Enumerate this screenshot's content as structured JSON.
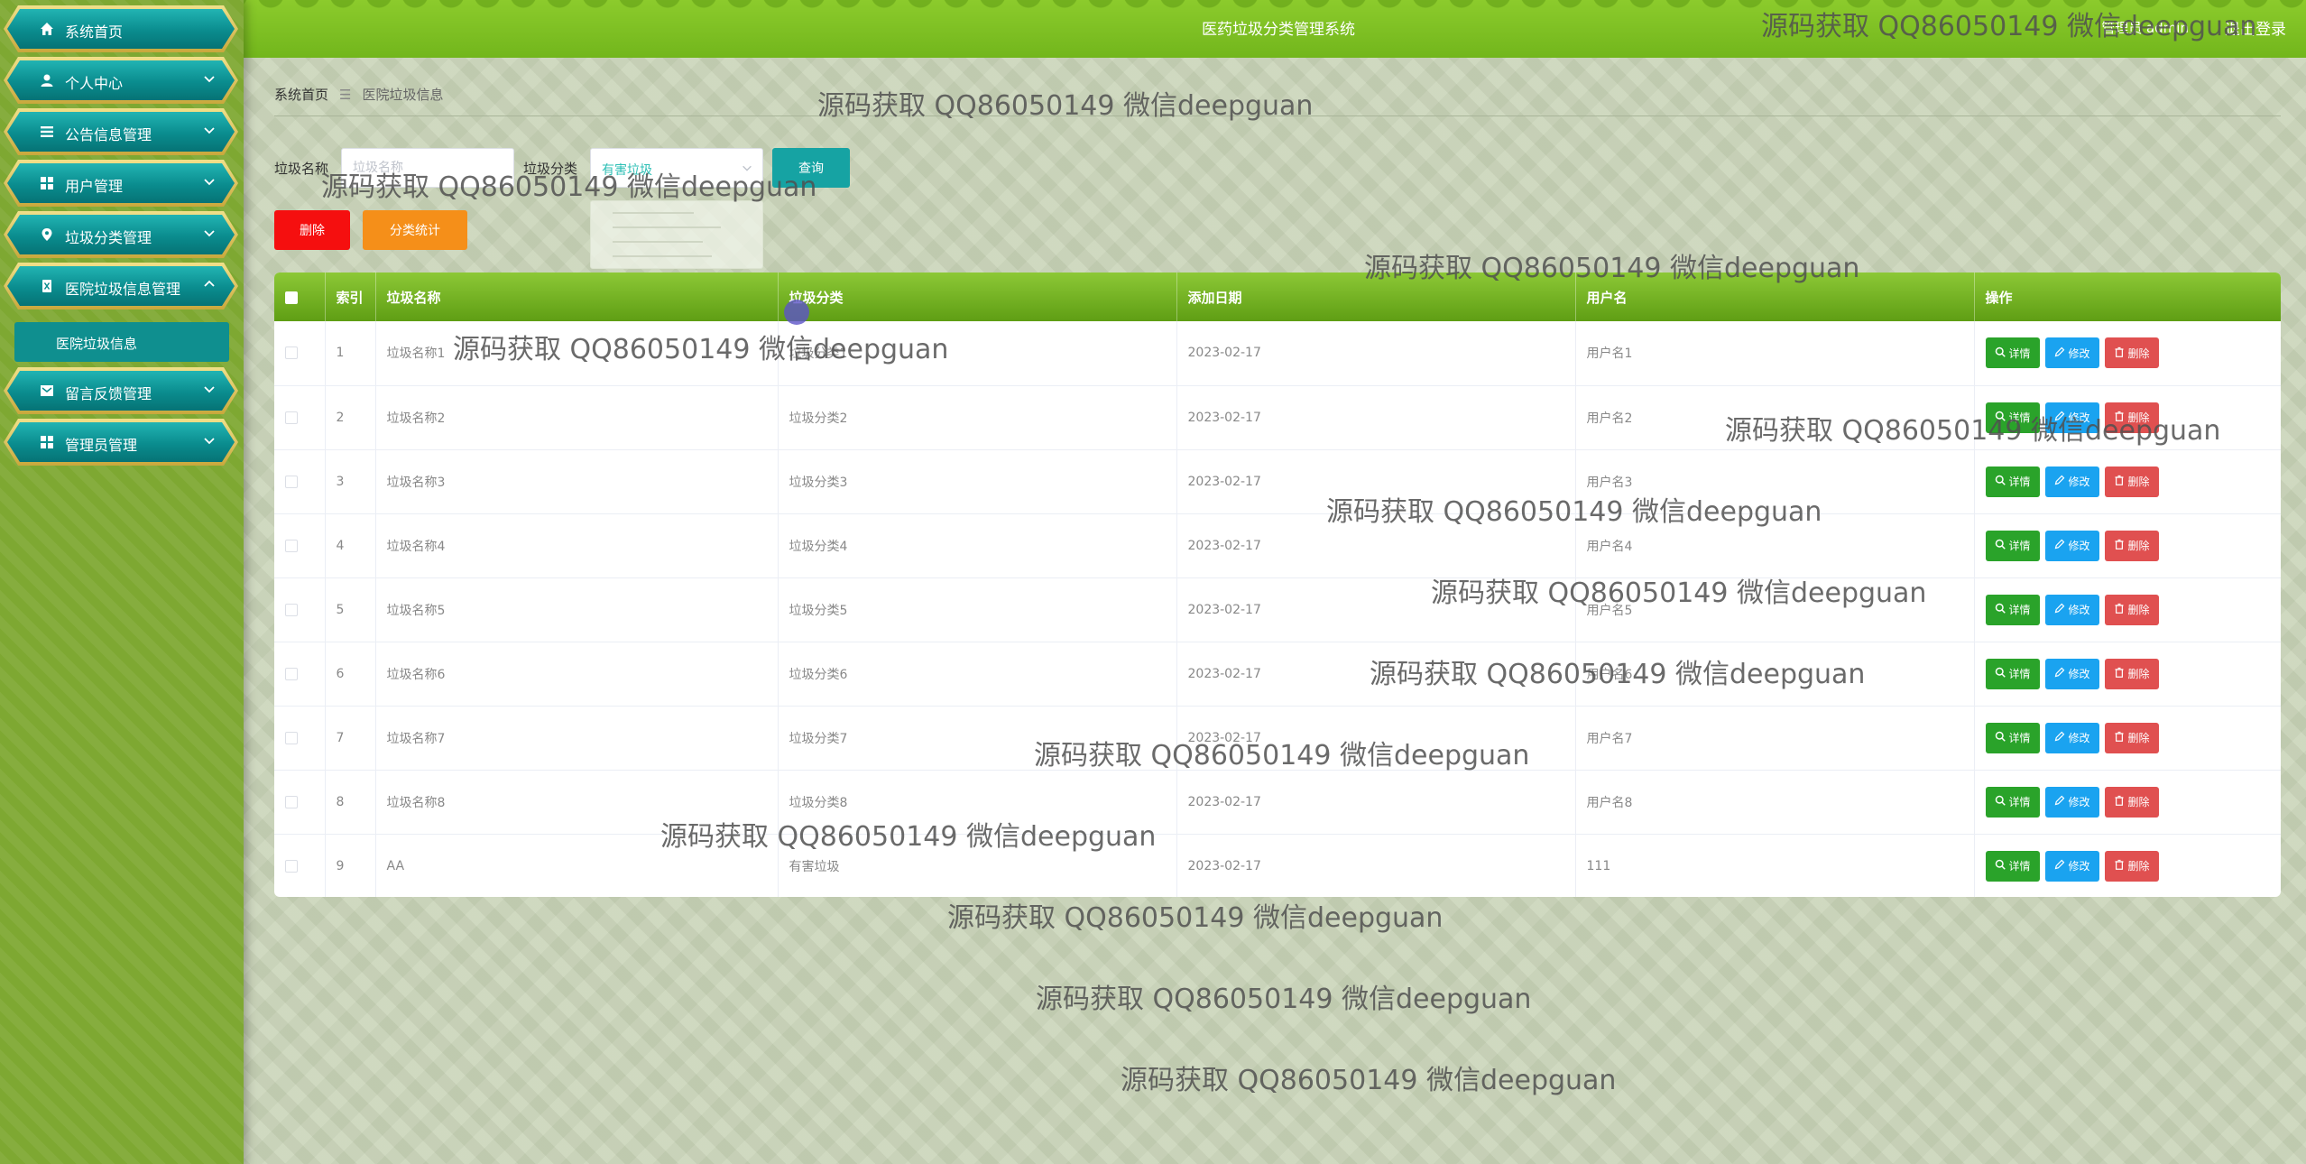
{
  "header": {
    "system_title": "医药垃圾分类管理系统",
    "admin_info": "管理员 admin",
    "logout_label": "退出登录"
  },
  "sidebar": {
    "items": [
      {
        "label": "系统首页",
        "icon": "home-icon"
      },
      {
        "label": "个人中心",
        "icon": "user-icon"
      },
      {
        "label": "公告信息管理",
        "icon": "list-icon"
      },
      {
        "label": "用户管理",
        "icon": "grid-icon"
      },
      {
        "label": "垃圾分类管理",
        "icon": "location-icon"
      },
      {
        "label": "医院垃圾信息管理",
        "icon": "trash-icon"
      },
      {
        "label": "留言反馈管理",
        "icon": "message-icon"
      },
      {
        "label": "管理员管理",
        "icon": "grid-icon"
      }
    ],
    "active_subitem": "医院垃圾信息"
  },
  "breadcrumb": {
    "home": "系统首页",
    "separator": "☰",
    "current": "医院垃圾信息"
  },
  "search": {
    "name_label": "垃圾名称",
    "name_placeholder": "垃圾名称",
    "category_label": "垃圾分类",
    "category_value": "有害垃圾",
    "query_button": "查询"
  },
  "actions": {
    "delete_button": "删除",
    "stats_button": "分类统计"
  },
  "table": {
    "columns": [
      "索引",
      "垃圾名称",
      "垃圾分类",
      "添加日期",
      "用户名",
      "操作"
    ],
    "rows": [
      {
        "index": "1",
        "name": "垃圾名称1",
        "category": "垃圾分类1",
        "date": "2023-02-17",
        "user": "用户名1"
      },
      {
        "index": "2",
        "name": "垃圾名称2",
        "category": "垃圾分类2",
        "date": "2023-02-17",
        "user": "用户名2"
      },
      {
        "index": "3",
        "name": "垃圾名称3",
        "category": "垃圾分类3",
        "date": "2023-02-17",
        "user": "用户名3"
      },
      {
        "index": "4",
        "name": "垃圾名称4",
        "category": "垃圾分类4",
        "date": "2023-02-17",
        "user": "用户名4"
      },
      {
        "index": "5",
        "name": "垃圾名称5",
        "category": "垃圾分类5",
        "date": "2023-02-17",
        "user": "用户名5"
      },
      {
        "index": "6",
        "name": "垃圾名称6",
        "category": "垃圾分类6",
        "date": "2023-02-17",
        "user": "用户名6"
      },
      {
        "index": "7",
        "name": "垃圾名称7",
        "category": "垃圾分类7",
        "date": "2023-02-17",
        "user": "用户名7"
      },
      {
        "index": "8",
        "name": "垃圾名称8",
        "category": "垃圾分类8",
        "date": "2023-02-17",
        "user": "用户名8"
      },
      {
        "index": "9",
        "name": "AA",
        "category": "有害垃圾",
        "date": "2023-02-17",
        "user": "111"
      }
    ],
    "op_labels": {
      "detail": "详情",
      "edit": "修改",
      "delete": "删除"
    }
  },
  "watermark": {
    "text": "源码获取 QQ86050149 微信deepguan"
  },
  "colors": {
    "header_green": "#7cbf22",
    "menu_teal": "#0a8c8e",
    "menu_rim_gold": "#d9c25a",
    "query_button": "#16a3a3",
    "delete_button": "#f50f0f",
    "stats_button": "#f58f19",
    "op_detail": "#2aa32a",
    "op_edit": "#1aa3f0",
    "op_delete": "#e05050"
  }
}
